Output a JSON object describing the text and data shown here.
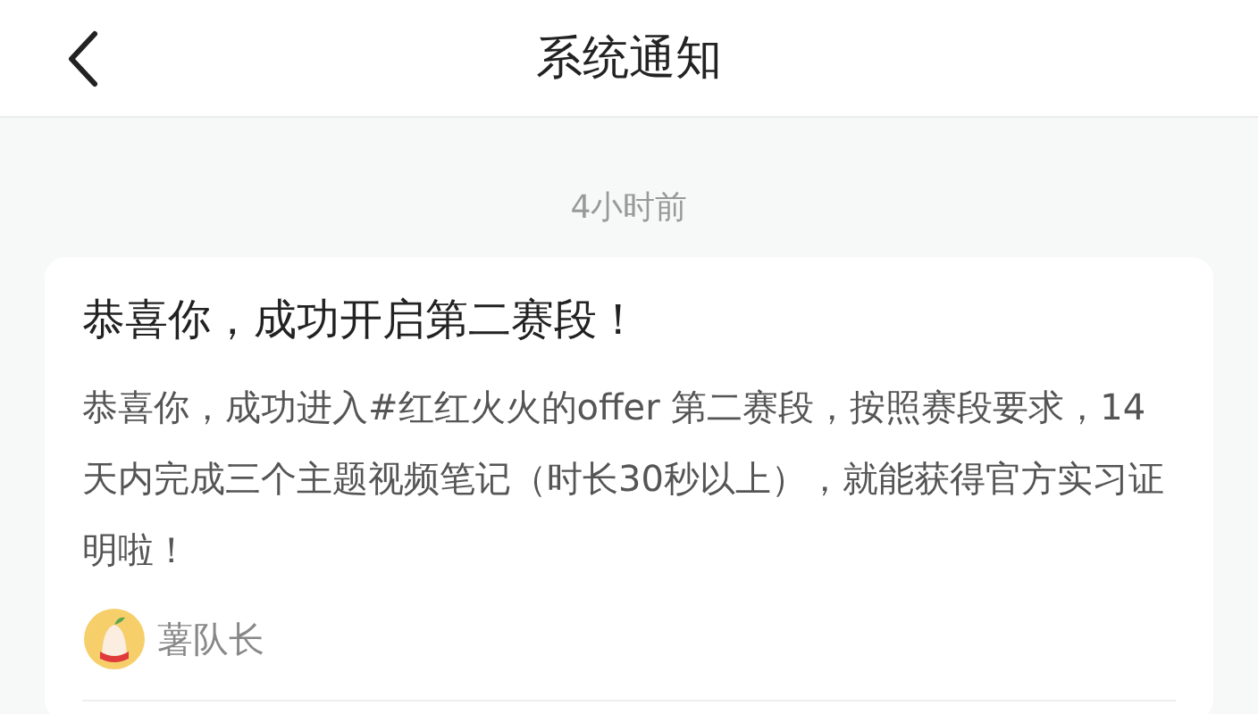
{
  "header": {
    "title": "系统通知"
  },
  "notification": {
    "time": "4小时前",
    "title": "恭喜你，成功开启第二赛段！",
    "body": "恭喜你，成功进入#红红火火的offer 第二赛段，按照赛段要求，14天内完成三个主题视频笔记（时长30秒以上），就能获得官方实习证明啦！",
    "sender": "薯队长"
  }
}
